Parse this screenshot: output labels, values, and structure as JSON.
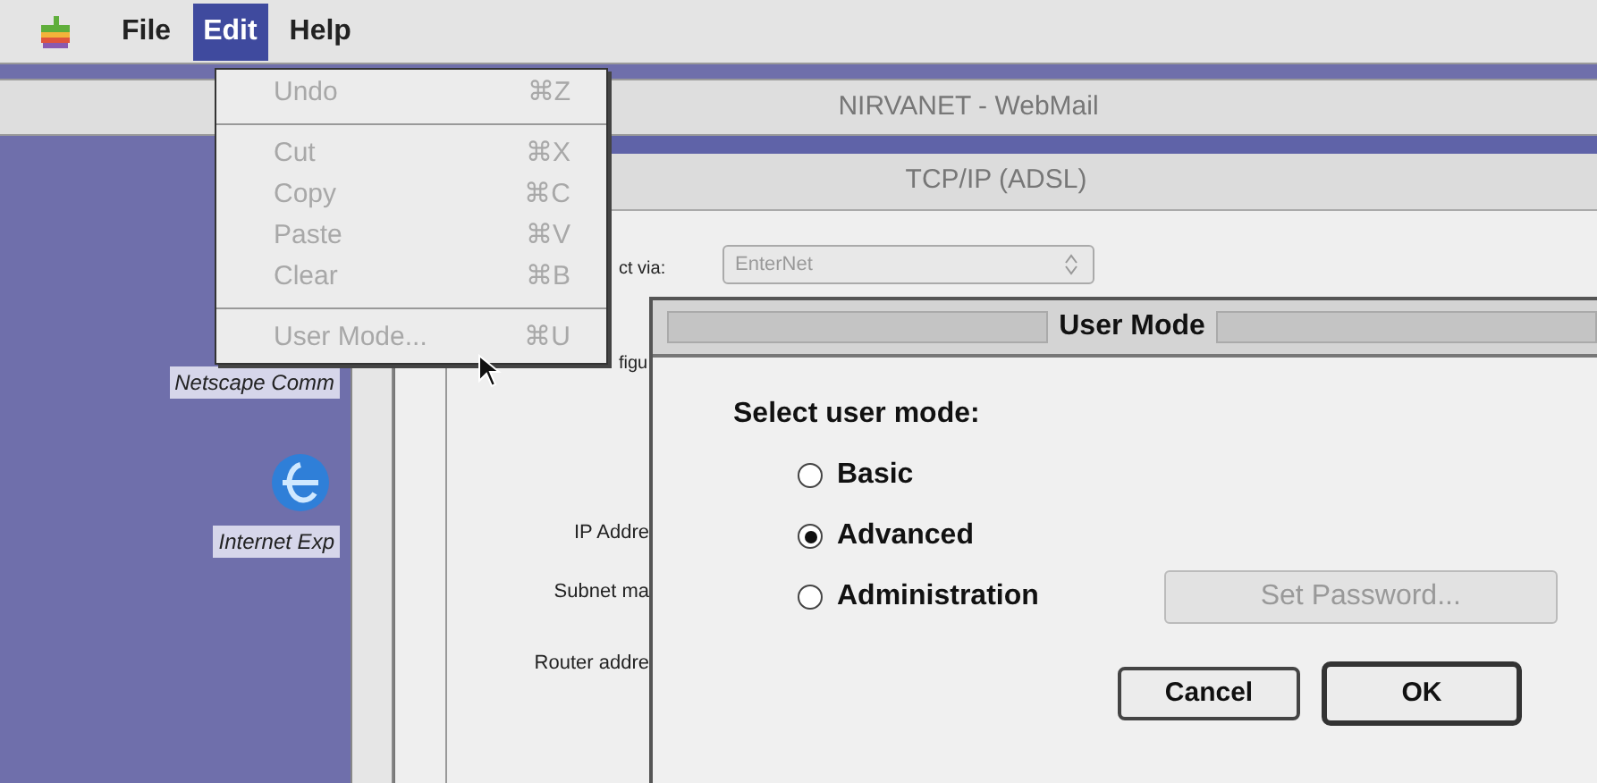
{
  "menu_bar": {
    "items": [
      {
        "label": "File",
        "selected": false
      },
      {
        "label": "Edit",
        "selected": true
      },
      {
        "label": "Help",
        "selected": false
      }
    ]
  },
  "edit_menu": {
    "items": [
      {
        "kind": "item",
        "label": "Undo",
        "shortcut": "⌘Z",
        "disabled": true
      },
      {
        "kind": "separator"
      },
      {
        "kind": "item",
        "label": "Cut",
        "shortcut": "⌘X",
        "disabled": true
      },
      {
        "kind": "item",
        "label": "Copy",
        "shortcut": "⌘C",
        "disabled": true
      },
      {
        "kind": "item",
        "label": "Paste",
        "shortcut": "⌘V",
        "disabled": true
      },
      {
        "kind": "item",
        "label": "Clear",
        "shortcut": "⌘B",
        "disabled": true
      },
      {
        "kind": "separator"
      },
      {
        "kind": "item",
        "label": "User Mode...",
        "shortcut": "⌘U",
        "disabled": true
      }
    ]
  },
  "webmail_window": {
    "title": "NIRVANET - WebMail"
  },
  "desktop_icons": [
    {
      "kind": "netscape",
      "label": "Netscape Comm"
    },
    {
      "kind": "explorer",
      "label": "Internet Exp"
    }
  ],
  "tcpip_window": {
    "title": "TCP/IP (ADSL)",
    "connect_label": "ct via:",
    "connect_value": "EnterNet",
    "configure_label": "figu",
    "fields": [
      "IP Addre",
      "Subnet ma",
      "Router addre"
    ]
  },
  "dialog": {
    "title": "User Mode",
    "prompt": "Select user mode:",
    "options": [
      {
        "label": "Basic",
        "selected": false
      },
      {
        "label": "Advanced",
        "selected": true
      },
      {
        "label": "Administration",
        "selected": false
      }
    ],
    "set_password": {
      "label": "Set Password...",
      "disabled": true
    },
    "buttons": [
      {
        "label": "Cancel",
        "default": false
      },
      {
        "label": "OK",
        "default": true
      }
    ]
  }
}
